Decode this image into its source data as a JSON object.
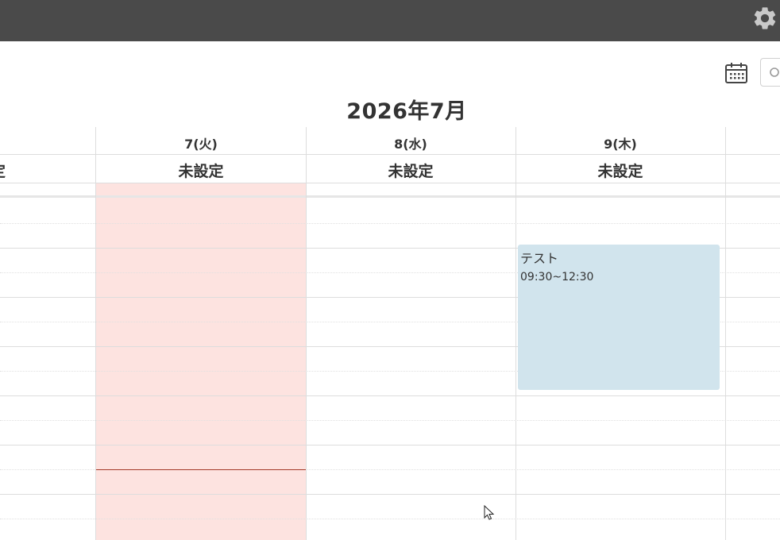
{
  "header": {
    "settings_icon": "gear-icon"
  },
  "toolbar": {
    "calendar_icon": "calendar-icon",
    "search_icon": "search-icon"
  },
  "title": "2026年7月",
  "days": [
    {
      "date": ")",
      "status": "設定"
    },
    {
      "date": "7(火)",
      "status": "未設定",
      "is_today": true
    },
    {
      "date": "8(水)",
      "status": "未設定"
    },
    {
      "date": "9(木)",
      "status": "未設定"
    }
  ],
  "events": [
    {
      "title": "テスト",
      "time": "09:30~12:30",
      "day": "9(木)"
    }
  ],
  "colors": {
    "topbar": "#4a4a4a",
    "today_bg": "#fde3e0",
    "event_bg": "#d1e4ed",
    "now_line": "#a33a2a"
  }
}
